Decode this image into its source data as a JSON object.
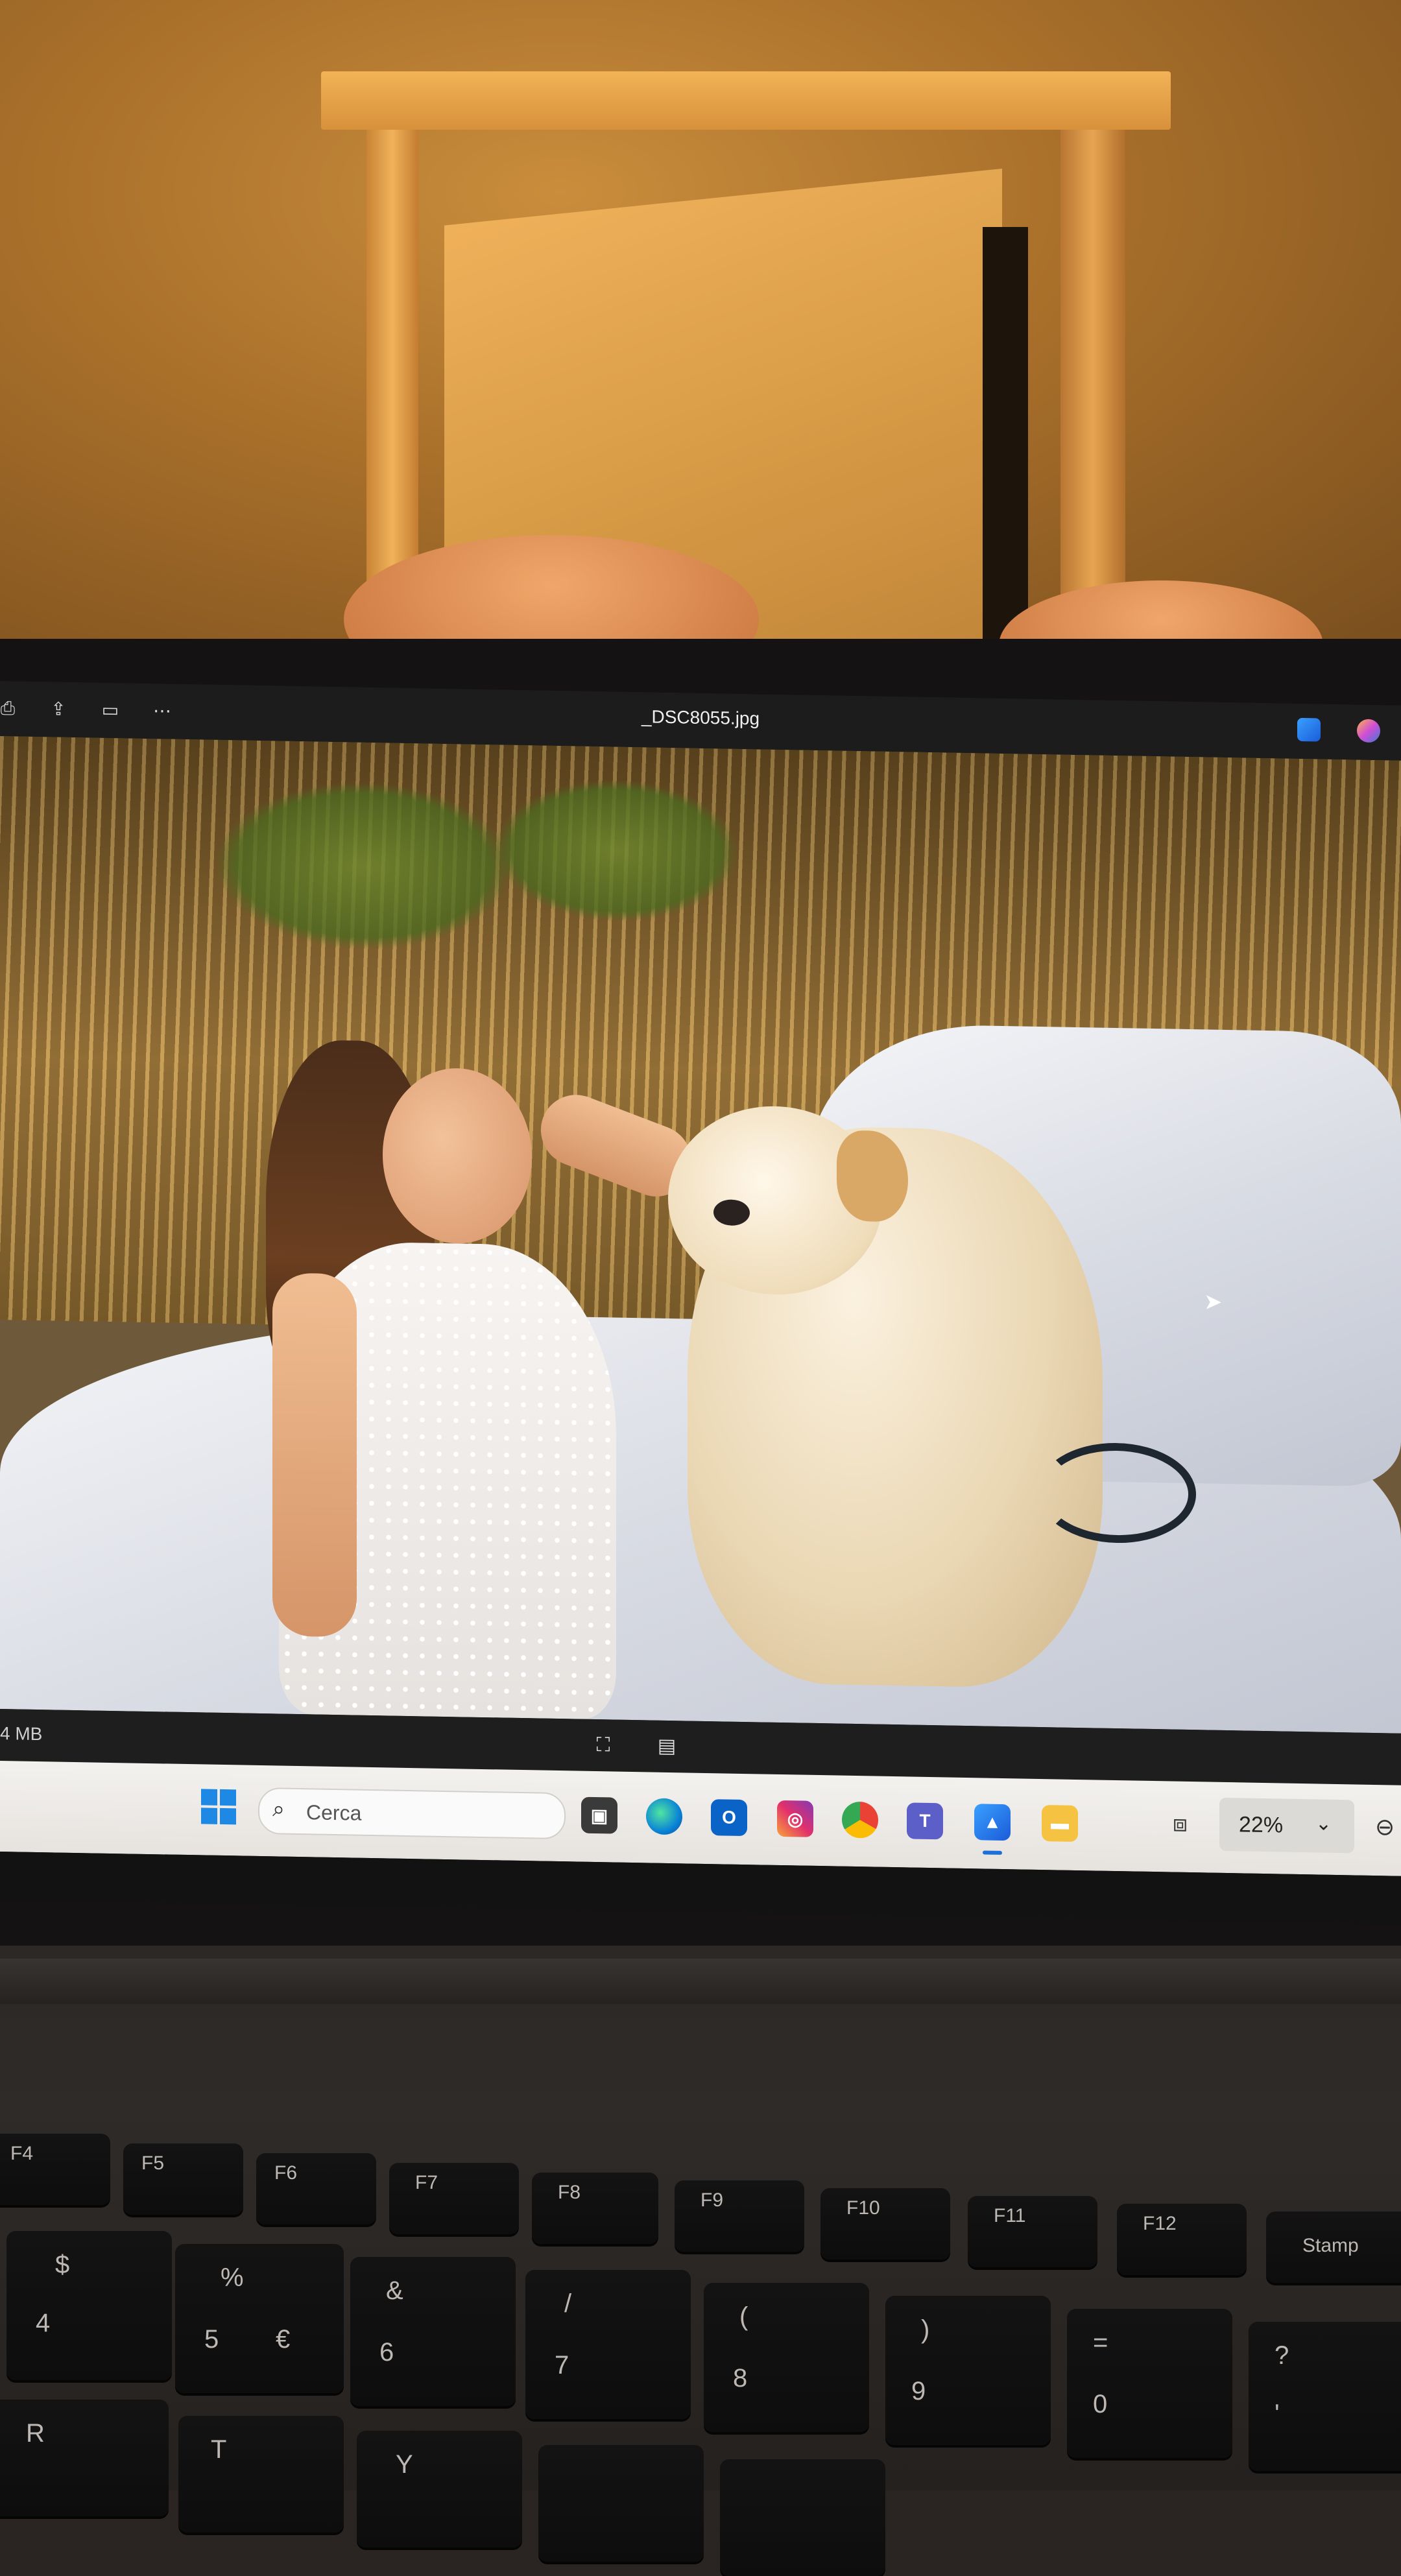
{
  "window": {
    "title": "_DSC8055.jpg"
  },
  "viewer": {
    "file_size_partial": "4 MB",
    "zoom": "22%"
  },
  "taskbar": {
    "search_placeholder": "Cerca",
    "apps": [
      "file-explorer-stack",
      "edge",
      "outlook",
      "instagram",
      "chrome",
      "teams",
      "photos",
      "file-explorer"
    ]
  },
  "keyboard": {
    "fn_row": [
      "F4",
      "F5",
      "F6",
      "F7",
      "F8",
      "F9",
      "F10",
      "F11",
      "F12",
      "Stamp"
    ],
    "number_row": [
      {
        "top": "$",
        "main": "4"
      },
      {
        "top": "%",
        "main": "5",
        "alt": "€"
      },
      {
        "top": "&",
        "main": "6"
      },
      {
        "top": "/",
        "main": "7"
      },
      {
        "top": "(",
        "main": "8"
      },
      {
        "top": ")",
        "main": "9"
      },
      {
        "top": "=",
        "main": "0"
      },
      {
        "top": "?",
        "main": "'"
      }
    ],
    "letter_row": [
      "R",
      "T",
      "Y"
    ]
  }
}
